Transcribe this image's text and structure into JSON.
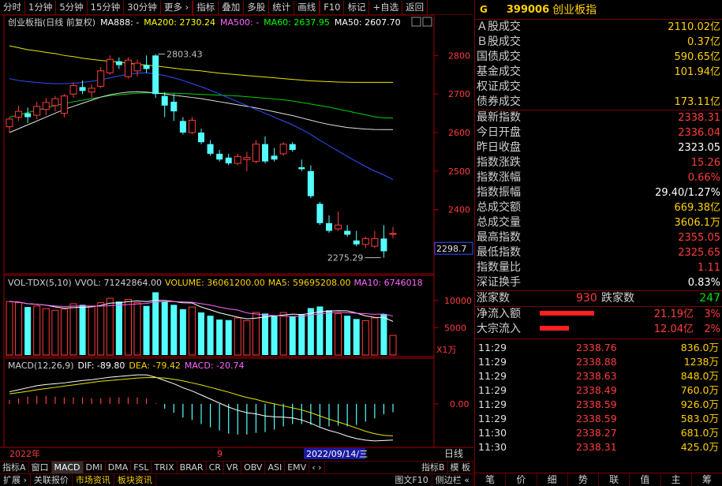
{
  "toolbar": {
    "items": [
      "分时",
      "1分钟",
      "5分钟",
      "15分钟",
      "30分钟",
      "更多 ›",
      "指标",
      "叠加",
      "多股",
      "统计",
      "画线",
      "F10",
      "标记",
      "+自选",
      "返回"
    ]
  },
  "chart": {
    "title": "创业板指(日线 前复权)",
    "legend": [
      {
        "text": "MA888: -",
        "color": "#ffffff"
      },
      {
        "text": "MA200: 2730.24",
        "color": "#ffff00"
      },
      {
        "text": "MA500: -",
        "color": "#ff66ff"
      },
      {
        "text": "MA60: 2637.95",
        "color": "#00ff00"
      },
      {
        "text": "MA50: 2607.70",
        "color": "#ffffff"
      }
    ],
    "price_axis": [
      "2800",
      "2700",
      "2600",
      "2500",
      "2400",
      "2300"
    ],
    "current_price_tag": "2298.7",
    "high_label": "2803.43",
    "low_label": "2275.29",
    "vol_legend": {
      "name": "VOL-TDX(5,10)",
      "vvol": "VVOL: 71242864.00",
      "volume": "VOLUME: 36061200.00",
      "ma5": "MA5: 59695208.00",
      "ma10": "MA10: 6746018"
    },
    "vol_axis": [
      "10000",
      "5000"
    ],
    "vol_unit": "X1万",
    "macd_legend": {
      "name": "MACD(12,26,9)",
      "dif": "DIF: -89.80",
      "dea": "DEA: -79.42",
      "macd": "MACD: -20.74"
    },
    "macd_axis": [
      "0.00"
    ],
    "date_axis": {
      "left": "2022年",
      "mid": "9",
      "cursor": "2022/09/14/三",
      "right": "日线"
    }
  },
  "tabs1": [
    "指标A",
    "窗口",
    "MACD",
    "DMI",
    "DMA",
    "FSL",
    "TRIX",
    "BRAR",
    "CR",
    "VR",
    "OBV",
    "ASI",
    "EMV",
    "‹ ›"
  ],
  "tabs1_right": [
    "指标B",
    "模 板"
  ],
  "tabs2": [
    "扩展 ›",
    "关联报价",
    "市场资讯",
    "板块资讯"
  ],
  "tabs2_right": [
    "图文F10",
    "侧边栏 «"
  ],
  "panel": {
    "g": "G",
    "code": "399006",
    "name": "创业板指",
    "volumes": [
      {
        "label": "Ａ股成交",
        "value": "2110.02亿",
        "color": "yellow"
      },
      {
        "label": "Ｂ股成交",
        "value": "0.37亿",
        "color": "yellow"
      },
      {
        "label": "国债成交",
        "value": "590.65亿",
        "color": "yellow"
      },
      {
        "label": "基金成交",
        "value": "101.94亿",
        "color": "yellow"
      },
      {
        "label": "权证成交",
        "value": "",
        "color": "yellow"
      },
      {
        "label": "债券成交",
        "value": "173.11亿",
        "color": "yellow"
      }
    ],
    "quotes": [
      {
        "label": "最新指数",
        "value": "2338.31",
        "color": "red"
      },
      {
        "label": "今日开盘",
        "value": "2336.04",
        "color": "red"
      },
      {
        "label": "昨日收盘",
        "value": "2323.05",
        "color": "white"
      },
      {
        "label": "指数涨跌",
        "value": "15.26",
        "color": "red"
      },
      {
        "label": "指数涨幅",
        "value": "0.66%",
        "color": "red"
      },
      {
        "label": "指数振幅",
        "value": "29.40/1.27%",
        "color": "white"
      },
      {
        "label": "总成交额",
        "value": "669.38亿",
        "color": "yellow"
      },
      {
        "label": "总成交量",
        "value": "3606.1万",
        "color": "yellow"
      },
      {
        "label": "最高指数",
        "value": "2355.05",
        "color": "red"
      },
      {
        "label": "最低指数",
        "value": "2325.65",
        "color": "red"
      },
      {
        "label": "指数量比",
        "value": "1.11",
        "color": "red"
      },
      {
        "label": "深证换手",
        "value": "0.83%",
        "color": "white"
      }
    ],
    "breadth": {
      "up_label": "涨家数",
      "up": "930",
      "down_label": "跌家数",
      "down": "247"
    },
    "flows": [
      {
        "label": "净流入额",
        "value": "21.19亿",
        "pct": "3%",
        "bar_frac": 0.75
      },
      {
        "label": "大宗流入",
        "value": "12.04亿",
        "pct": "2%",
        "bar_frac": 0.4
      }
    ],
    "ticks": [
      {
        "time": "11:29",
        "price": "2338.76",
        "vol": "836.0万"
      },
      {
        "time": "11:29",
        "price": "2338.88",
        "vol": "1238万"
      },
      {
        "time": "11:29",
        "price": "2338.63",
        "vol": "848.0万"
      },
      {
        "time": "11:29",
        "price": "2338.49",
        "vol": "760.0万"
      },
      {
        "time": "11:29",
        "price": "2338.59",
        "vol": "926.0万"
      },
      {
        "time": "11:29",
        "price": "2338.59",
        "vol": "583.0万"
      },
      {
        "time": "11:30",
        "price": "2338.27",
        "vol": "681.0万"
      },
      {
        "time": "11:30",
        "price": "2338.31",
        "vol": "425.0万"
      }
    ],
    "footer": [
      "笔",
      "价",
      "细",
      "势",
      "联",
      "值",
      "主",
      "筹"
    ]
  },
  "chart_data": {
    "type": "candlestick",
    "price_ylim": [
      2250,
      2860
    ],
    "candles": [
      {
        "o": 2615,
        "h": 2640,
        "l": 2600,
        "c": 2635
      },
      {
        "o": 2640,
        "h": 2670,
        "l": 2630,
        "c": 2655
      },
      {
        "o": 2650,
        "h": 2665,
        "l": 2625,
        "c": 2640
      },
      {
        "o": 2645,
        "h": 2680,
        "l": 2635,
        "c": 2668
      },
      {
        "o": 2660,
        "h": 2690,
        "l": 2645,
        "c": 2678
      },
      {
        "o": 2670,
        "h": 2695,
        "l": 2655,
        "c": 2688
      },
      {
        "o": 2650,
        "h": 2700,
        "l": 2640,
        "c": 2695
      },
      {
        "o": 2700,
        "h": 2730,
        "l": 2690,
        "c": 2722
      },
      {
        "o": 2718,
        "h": 2735,
        "l": 2700,
        "c": 2708
      },
      {
        "o": 2705,
        "h": 2725,
        "l": 2690,
        "c": 2715
      },
      {
        "o": 2720,
        "h": 2770,
        "l": 2715,
        "c": 2760
      },
      {
        "o": 2755,
        "h": 2800,
        "l": 2750,
        "c": 2790
      },
      {
        "o": 2785,
        "h": 2795,
        "l": 2765,
        "c": 2775
      },
      {
        "o": 2745,
        "h": 2795,
        "l": 2740,
        "c": 2788
      },
      {
        "o": 2760,
        "h": 2790,
        "l": 2745,
        "c": 2780
      },
      {
        "o": 2775,
        "h": 2800,
        "l": 2755,
        "c": 2765
      },
      {
        "o": 2800,
        "h": 2803.43,
        "l": 2690,
        "c": 2700
      },
      {
        "o": 2695,
        "h": 2705,
        "l": 2640,
        "c": 2670
      },
      {
        "o": 2680,
        "h": 2700,
        "l": 2630,
        "c": 2655
      },
      {
        "o": 2630,
        "h": 2640,
        "l": 2595,
        "c": 2600
      },
      {
        "o": 2600,
        "h": 2640,
        "l": 2595,
        "c": 2632
      },
      {
        "o": 2600,
        "h": 2610,
        "l": 2570,
        "c": 2575
      },
      {
        "o": 2570,
        "h": 2580,
        "l": 2540,
        "c": 2545
      },
      {
        "o": 2545,
        "h": 2555,
        "l": 2525,
        "c": 2530
      },
      {
        "o": 2535,
        "h": 2545,
        "l": 2515,
        "c": 2520
      },
      {
        "o": 2520,
        "h": 2545,
        "l": 2515,
        "c": 2538
      },
      {
        "o": 2530,
        "h": 2550,
        "l": 2500,
        "c": 2535
      },
      {
        "o": 2525,
        "h": 2580,
        "l": 2520,
        "c": 2570
      },
      {
        "o": 2570,
        "h": 2590,
        "l": 2520,
        "c": 2525
      },
      {
        "o": 2540,
        "h": 2560,
        "l": 2525,
        "c": 2530
      },
      {
        "o": 2545,
        "h": 2575,
        "l": 2540,
        "c": 2570
      },
      {
        "o": 2570,
        "h": 2575,
        "l": 2550,
        "c": 2555
      },
      {
        "o": 2510,
        "h": 2530,
        "l": 2500,
        "c": 2505
      },
      {
        "o": 2500,
        "h": 2515,
        "l": 2430,
        "c": 2435
      },
      {
        "o": 2415,
        "h": 2420,
        "l": 2360,
        "c": 2365
      },
      {
        "o": 2365,
        "h": 2385,
        "l": 2340,
        "c": 2345
      },
      {
        "o": 2350,
        "h": 2395,
        "l": 2345,
        "c": 2360
      },
      {
        "o": 2345,
        "h": 2360,
        "l": 2330,
        "c": 2335
      },
      {
        "o": 2320,
        "h": 2345,
        "l": 2305,
        "c": 2310
      },
      {
        "o": 2310,
        "h": 2330,
        "l": 2300,
        "c": 2325
      },
      {
        "o": 2305,
        "h": 2345,
        "l": 2300,
        "c": 2325
      },
      {
        "o": 2325,
        "h": 2360,
        "l": 2275.29,
        "c": 2292
      },
      {
        "o": 2336.04,
        "h": 2355.05,
        "l": 2325.65,
        "c": 2338.31
      }
    ],
    "ma200": [
      2825,
      2820,
      2815,
      2812,
      2808,
      2805,
      2800,
      2797,
      2793,
      2790,
      2787,
      2785,
      2783,
      2780,
      2777,
      2775,
      2773,
      2770,
      2767,
      2764,
      2762,
      2760,
      2757,
      2754,
      2752,
      2750,
      2748,
      2746,
      2744,
      2742,
      2740,
      2738,
      2736,
      2734,
      2733,
      2732,
      2731,
      2730.5,
      2730.4,
      2730.3,
      2730.24,
      2730.2,
      2730.24
    ],
    "ma60": [
      2640,
      2645,
      2652,
      2658,
      2664,
      2670,
      2675,
      2680,
      2684,
      2688,
      2692,
      2696,
      2698,
      2700,
      2702,
      2703,
      2703,
      2702,
      2702,
      2701,
      2700,
      2699,
      2698,
      2697,
      2696,
      2695,
      2693,
      2691,
      2689,
      2687,
      2685,
      2682,
      2678,
      2674,
      2670,
      2666,
      2661,
      2656,
      2651,
      2646,
      2641,
      2638,
      2637.95
    ],
    "ma50": [
      2600,
      2610,
      2620,
      2630,
      2640,
      2650,
      2660,
      2668,
      2676,
      2684,
      2692,
      2698,
      2702,
      2705,
      2706,
      2705,
      2703,
      2700,
      2697,
      2694,
      2691,
      2688,
      2684,
      2680,
      2676,
      2672,
      2668,
      2664,
      2659,
      2654,
      2649,
      2644,
      2638,
      2632,
      2626,
      2621,
      2617,
      2613,
      2611,
      2609,
      2608,
      2607.8,
      2607.7
    ],
    "ma_blue": [
      2740,
      2735,
      2732,
      2730,
      2728,
      2727,
      2727,
      2728,
      2730,
      2733,
      2737,
      2742,
      2747,
      2751,
      2754,
      2755,
      2752,
      2748,
      2742,
      2735,
      2727,
      2719,
      2710,
      2700,
      2690,
      2680,
      2670,
      2660,
      2650,
      2640,
      2630,
      2620,
      2608,
      2595,
      2580,
      2566,
      2552,
      2538,
      2525,
      2512,
      2500,
      2490,
      2478
    ],
    "volumes": [
      9800,
      9600,
      8800,
      9000,
      8500,
      8200,
      8400,
      9400,
      9200,
      8900,
      9600,
      10400,
      9800,
      10200,
      9600,
      9000,
      11500,
      9800,
      9200,
      8400,
      8800,
      7800,
      7200,
      6500,
      6400,
      6800,
      6300,
      7800,
      7600,
      7200,
      7800,
      7100,
      7400,
      8600,
      8900,
      8200,
      7600,
      7200,
      6600,
      6300,
      6800,
      7500,
      3606
    ],
    "vol_ylim": [
      0,
      12000
    ],
    "dif": [
      30,
      35,
      40,
      45,
      48,
      50,
      52,
      55,
      58,
      60,
      63,
      66,
      68,
      70,
      72,
      72,
      66,
      58,
      50,
      40,
      32,
      22,
      12,
      2,
      -8,
      -16,
      -22,
      -25,
      -30,
      -32,
      -33,
      -35,
      -40,
      -48,
      -58,
      -66,
      -72,
      -80,
      -86,
      -90,
      -92,
      -91,
      -89.8
    ],
    "dea": [
      25,
      28,
      31,
      35,
      38,
      41,
      44,
      47,
      50,
      53,
      56,
      58,
      60,
      62,
      64,
      65,
      65,
      64,
      61,
      57,
      52,
      47,
      41,
      35,
      29,
      22,
      16,
      11,
      5,
      0,
      -5,
      -10,
      -15,
      -22,
      -30,
      -38,
      -45,
      -52,
      -60,
      -68,
      -74,
      -78,
      -79.42
    ],
    "macd_ylim": [
      -100,
      80
    ]
  }
}
